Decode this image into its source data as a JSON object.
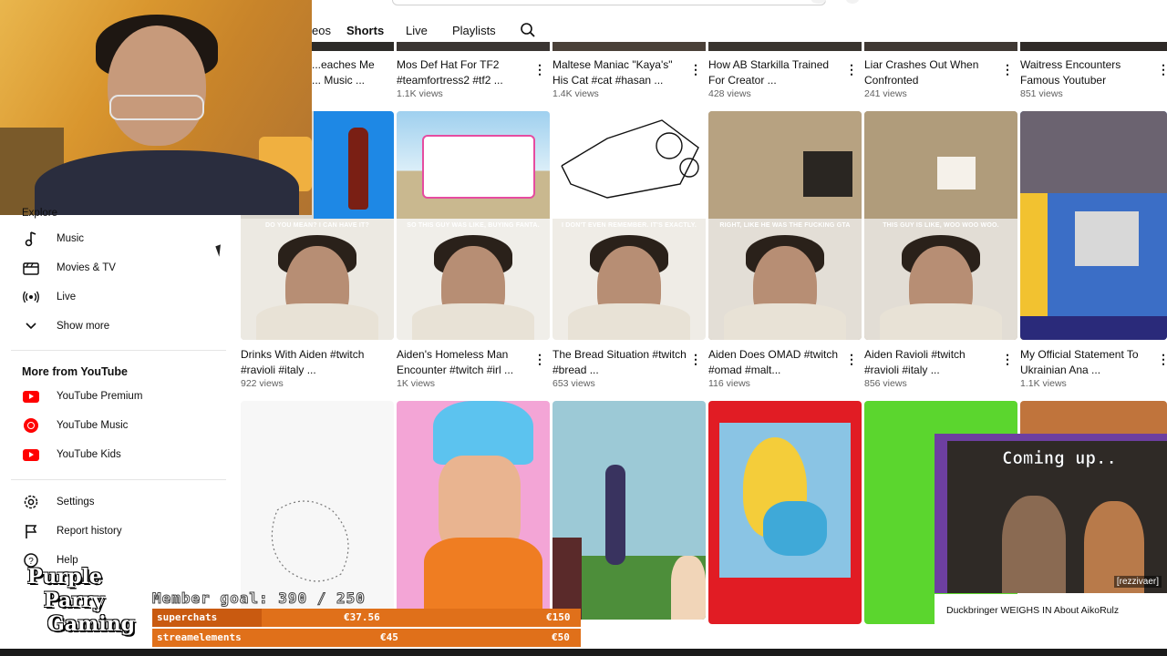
{
  "tabs": {
    "partial": "eos",
    "shorts": "Shorts",
    "live": "Live",
    "playlists": "Playlists"
  },
  "sidebar": {
    "explore_partial": "Explore",
    "items": [
      {
        "label": "Music",
        "icon": "music-note-icon"
      },
      {
        "label": "Movies & TV",
        "icon": "clapperboard-icon"
      },
      {
        "label": "Live",
        "icon": "live-broadcast-icon"
      },
      {
        "label": "Show more",
        "icon": "chevron-down-icon"
      }
    ],
    "more_from_youtube": {
      "heading": "More from YouTube",
      "items": [
        {
          "label": "YouTube Premium",
          "icon": "youtube-premium-icon"
        },
        {
          "label": "YouTube Music",
          "icon": "youtube-music-icon"
        },
        {
          "label": "YouTube Kids",
          "icon": "youtube-kids-icon"
        }
      ]
    },
    "settings": "Settings",
    "report_history": "Report history",
    "help": "Help"
  },
  "row1": [
    {
      "title": "...eaches Me ... Music ...",
      "views": ""
    },
    {
      "title": "Mos Def Hat For TF2 #teamfortress2 #tf2 ...",
      "views": "1.1K views"
    },
    {
      "title": "Maltese Maniac \"Kaya's\" His Cat #cat #hasan ...",
      "views": "1.4K views"
    },
    {
      "title": "How AB Starkilla Trained For Creator ...",
      "views": "428 views"
    },
    {
      "title": "Liar Crashes Out When Confronted",
      "views": "241 views"
    },
    {
      "title": "Waitress Encounters Famous Youtuber",
      "views": "851 views"
    }
  ],
  "row2": [
    {
      "title": "Drinks With Aiden #twitch #ravioli #italy ...",
      "views": "922 views",
      "caption": "DO YOU MEAN? I CAN HAVE IT?"
    },
    {
      "title": "Aiden's Homeless Man Encounter #twitch #irl ...",
      "views": "1K views",
      "caption": "SO THIS GUY WAS LIKE, BUYING FANTA."
    },
    {
      "title": "The Bread Situation #twitch #bread ...",
      "views": "653 views",
      "caption": "I DON'T EVEN REMEMBER. IT'S EXACTLY."
    },
    {
      "title": "Aiden Does OMAD #twitch #omad #malt...",
      "views": "116 views",
      "caption": "RIGHT, LIKE HE WAS THE FUCKING GTA"
    },
    {
      "title": "Aiden Ravioli #twitch #ravioli #italy ...",
      "views": "856 views",
      "caption": "THIS GUY IS LIKE, WOO WOO WOO."
    },
    {
      "title": "My Official Statement To Ukrainian Ana ...",
      "views": "1.1K views",
      "caption": ""
    }
  ],
  "overlay": {
    "member_goal": "Member goal: 390 / 250",
    "superchats_label": "superchats",
    "superchats_value": "€37.56",
    "superchats_goal": "€150",
    "streamelements_label": "streamelements",
    "streamelements_value": "€45",
    "streamelements_goal": "€50",
    "logo_line1": "Purple",
    "logo_line2": "Parry",
    "logo_line3": "Gaming",
    "coming_up": "Coming up..",
    "coming_up_name": "[rezzivaer]",
    "next_title": "Duckbringer WEIGHS IN About AikoRulz"
  },
  "colors": {
    "accent": "#ff0000",
    "overlay_orange": "#e0701a",
    "overlay_purple": "#6d3fa0"
  }
}
